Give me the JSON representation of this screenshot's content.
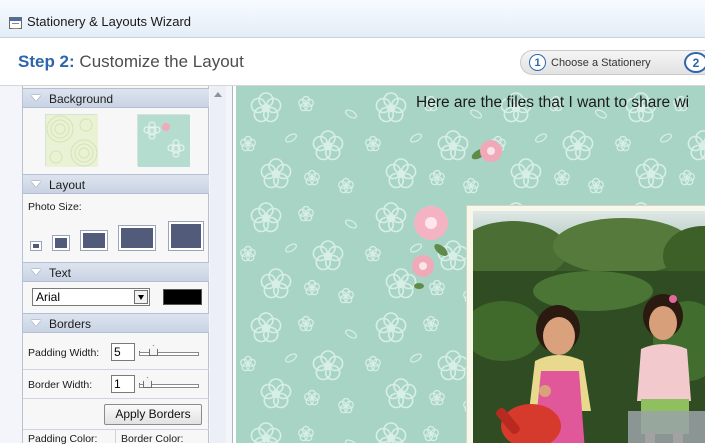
{
  "window": {
    "title": "Stationery & Layouts Wizard"
  },
  "header": {
    "step_number": "Step 2:",
    "step_title": " Customize the Layout",
    "breadcrumb": [
      {
        "num": "1",
        "label": "Choose a Stationery"
      },
      {
        "num": "2",
        "label": ""
      }
    ]
  },
  "panel": {
    "background": {
      "title": "Background"
    },
    "layout": {
      "title": "Layout",
      "photo_size_label": "Photo Size:"
    },
    "text": {
      "title": "Text",
      "font": "Arial",
      "color": "#000000"
    },
    "borders": {
      "title": "Borders",
      "padding_width_label": "Padding Width:",
      "padding_width_value": "5",
      "border_width_label": "Border Width:",
      "border_width_value": "1",
      "apply_label": "Apply Borders",
      "padding_color_label": "Padding Color:",
      "border_color_label": "Border Color:"
    }
  },
  "preview": {
    "greeting": "Here are the files that I want to share wi"
  },
  "colors": {
    "accent": "#2e66a9",
    "stationery_bg": "#a8d4c6"
  }
}
